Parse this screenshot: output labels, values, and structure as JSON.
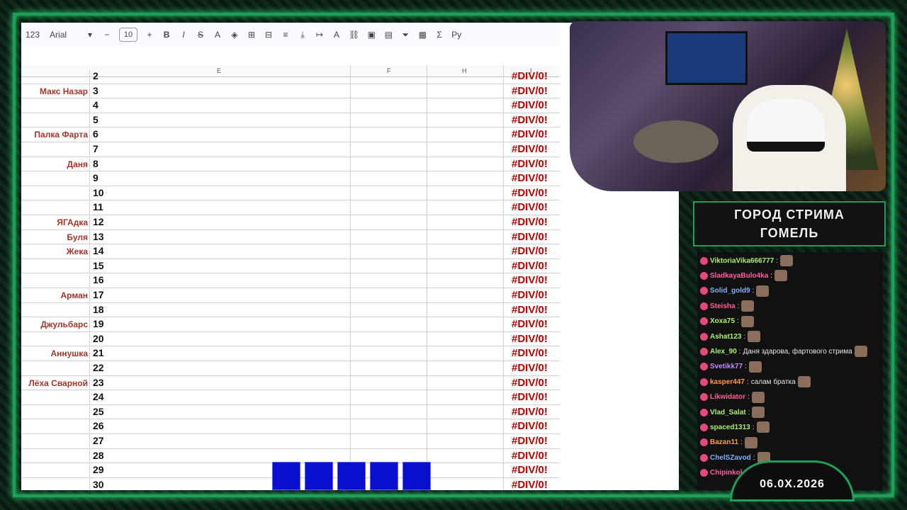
{
  "toolbar": {
    "zoom_label": "123",
    "font": "Arial",
    "font_size": "10",
    "bold": "B",
    "italic": "I",
    "strike": "S",
    "text_color": "A",
    "sigma": "Σ",
    "lang": "Ру"
  },
  "columns": {
    "e": "E",
    "f": "F",
    "h": "H",
    "i": "I"
  },
  "rows": [
    {
      "name": "",
      "num": "2"
    },
    {
      "name": "Макс Назар",
      "num": "3"
    },
    {
      "name": "",
      "num": "4"
    },
    {
      "name": "",
      "num": "5"
    },
    {
      "name": "Палка Фарта",
      "num": "6"
    },
    {
      "name": "",
      "num": "7"
    },
    {
      "name": "Даня",
      "num": "8"
    },
    {
      "name": "",
      "num": "9"
    },
    {
      "name": "",
      "num": "10"
    },
    {
      "name": "",
      "num": "11"
    },
    {
      "name": "ЯГАдка",
      "num": "12"
    },
    {
      "name": "Буля",
      "num": "13"
    },
    {
      "name": "Жека",
      "num": "14"
    },
    {
      "name": "",
      "num": "15"
    },
    {
      "name": "",
      "num": "16"
    },
    {
      "name": "Арман",
      "num": "17"
    },
    {
      "name": "",
      "num": "18"
    },
    {
      "name": "Джульбарс",
      "num": "19"
    },
    {
      "name": "",
      "num": "20"
    },
    {
      "name": "Аннушка",
      "num": "21"
    },
    {
      "name": "",
      "num": "22"
    },
    {
      "name": "Лёха Сварной",
      "num": "23"
    },
    {
      "name": "",
      "num": "24"
    },
    {
      "name": "",
      "num": "25"
    },
    {
      "name": "",
      "num": "26"
    },
    {
      "name": "",
      "num": "27"
    },
    {
      "name": "",
      "num": "28"
    },
    {
      "name": "",
      "num": "29"
    },
    {
      "name": "",
      "num": "30"
    }
  ],
  "error_value": "#DIV/0!",
  "title": {
    "line1": "ГОРОД СТРИМА",
    "line2": "ГОМЕЛЬ"
  },
  "chat": [
    {
      "user": "ViktoriaVika666777",
      "color": "#a9f06b",
      "msg": ""
    },
    {
      "user": "SladkayaBulo4ka",
      "color": "#ff5fa2",
      "msg": ""
    },
    {
      "user": "Solid_gold9",
      "color": "#7fb0ff",
      "msg": ""
    },
    {
      "user": "Steisha",
      "color": "#ff5fa2",
      "msg": ""
    },
    {
      "user": "Xoxa75",
      "color": "#a9f06b",
      "msg": ""
    },
    {
      "user": "Ashat123",
      "color": "#a9f06b",
      "msg": ""
    },
    {
      "user": "Alex_90",
      "color": "#a9f06b",
      "msg": "Даня здарова, фартового стрима"
    },
    {
      "user": "Svetikk77",
      "color": "#c48bff",
      "msg": ""
    },
    {
      "user": "kasper447",
      "color": "#ff9a4a",
      "msg": "салам братка"
    },
    {
      "user": "Likwidator",
      "color": "#ff5fa2",
      "msg": ""
    },
    {
      "user": "Vlad_Salat",
      "color": "#a9f06b",
      "msg": ""
    },
    {
      "user": "spaced1313",
      "color": "#a9f06b",
      "msg": ""
    },
    {
      "user": "Bazan11",
      "color": "#ff9a4a",
      "msg": ""
    },
    {
      "user": "ChelSZavod",
      "color": "#7fb0ff",
      "msg": ""
    },
    {
      "user": "Chipinkol",
      "color": "#ff5fa2",
      "msg": ""
    }
  ],
  "date": "06.0Х.2026"
}
